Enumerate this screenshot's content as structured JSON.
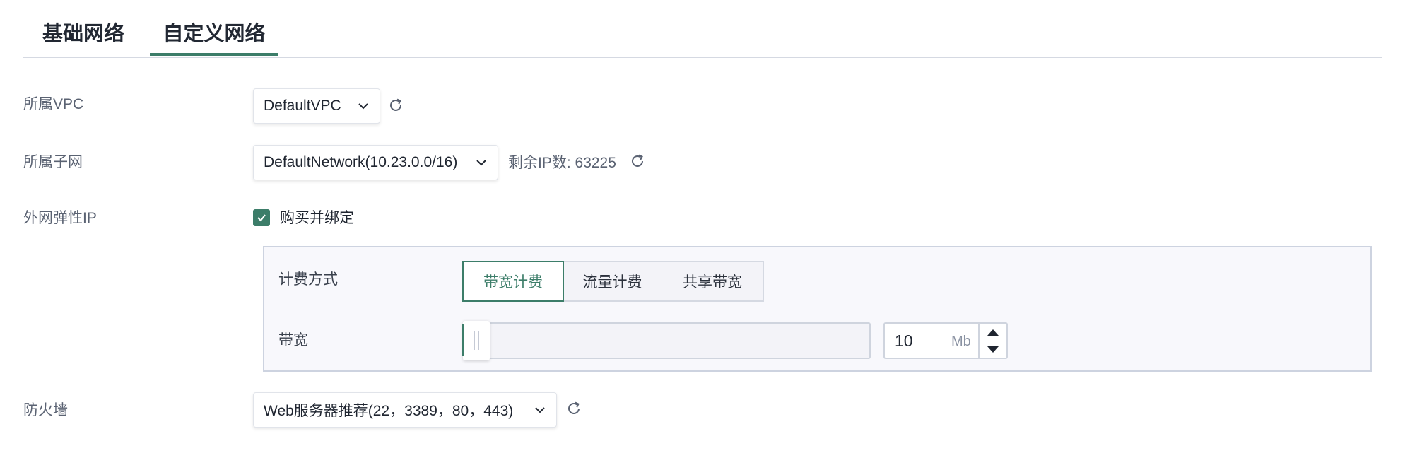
{
  "tabs": [
    {
      "label": "基础网络",
      "active": false
    },
    {
      "label": "自定义网络",
      "active": true
    }
  ],
  "colors": {
    "accent": "#3c7d69",
    "border": "#cdd3e0"
  },
  "form": {
    "vpc": {
      "label": "所属VPC",
      "value": "DefaultVPC",
      "icon": "refresh-icon"
    },
    "subnet": {
      "label": "所属子网",
      "value": "DefaultNetwork(10.23.0.0/16)",
      "remaining_ip": "剩余IP数: 63225",
      "icon": "refresh-icon"
    },
    "eip": {
      "label": "外网弹性IP",
      "checkbox_label": "购买并绑定",
      "checked": true,
      "billing": {
        "label": "计费方式",
        "options": [
          "带宽计费",
          "流量计费",
          "共享带宽"
        ],
        "selected": "带宽计费"
      },
      "bandwidth": {
        "label": "带宽",
        "value": "10",
        "unit": "Mb",
        "slider_fraction": 0
      }
    },
    "firewall": {
      "label": "防火墙",
      "value": "Web服务器推荐(22，3389，80，443)",
      "icon": "refresh-icon"
    }
  }
}
